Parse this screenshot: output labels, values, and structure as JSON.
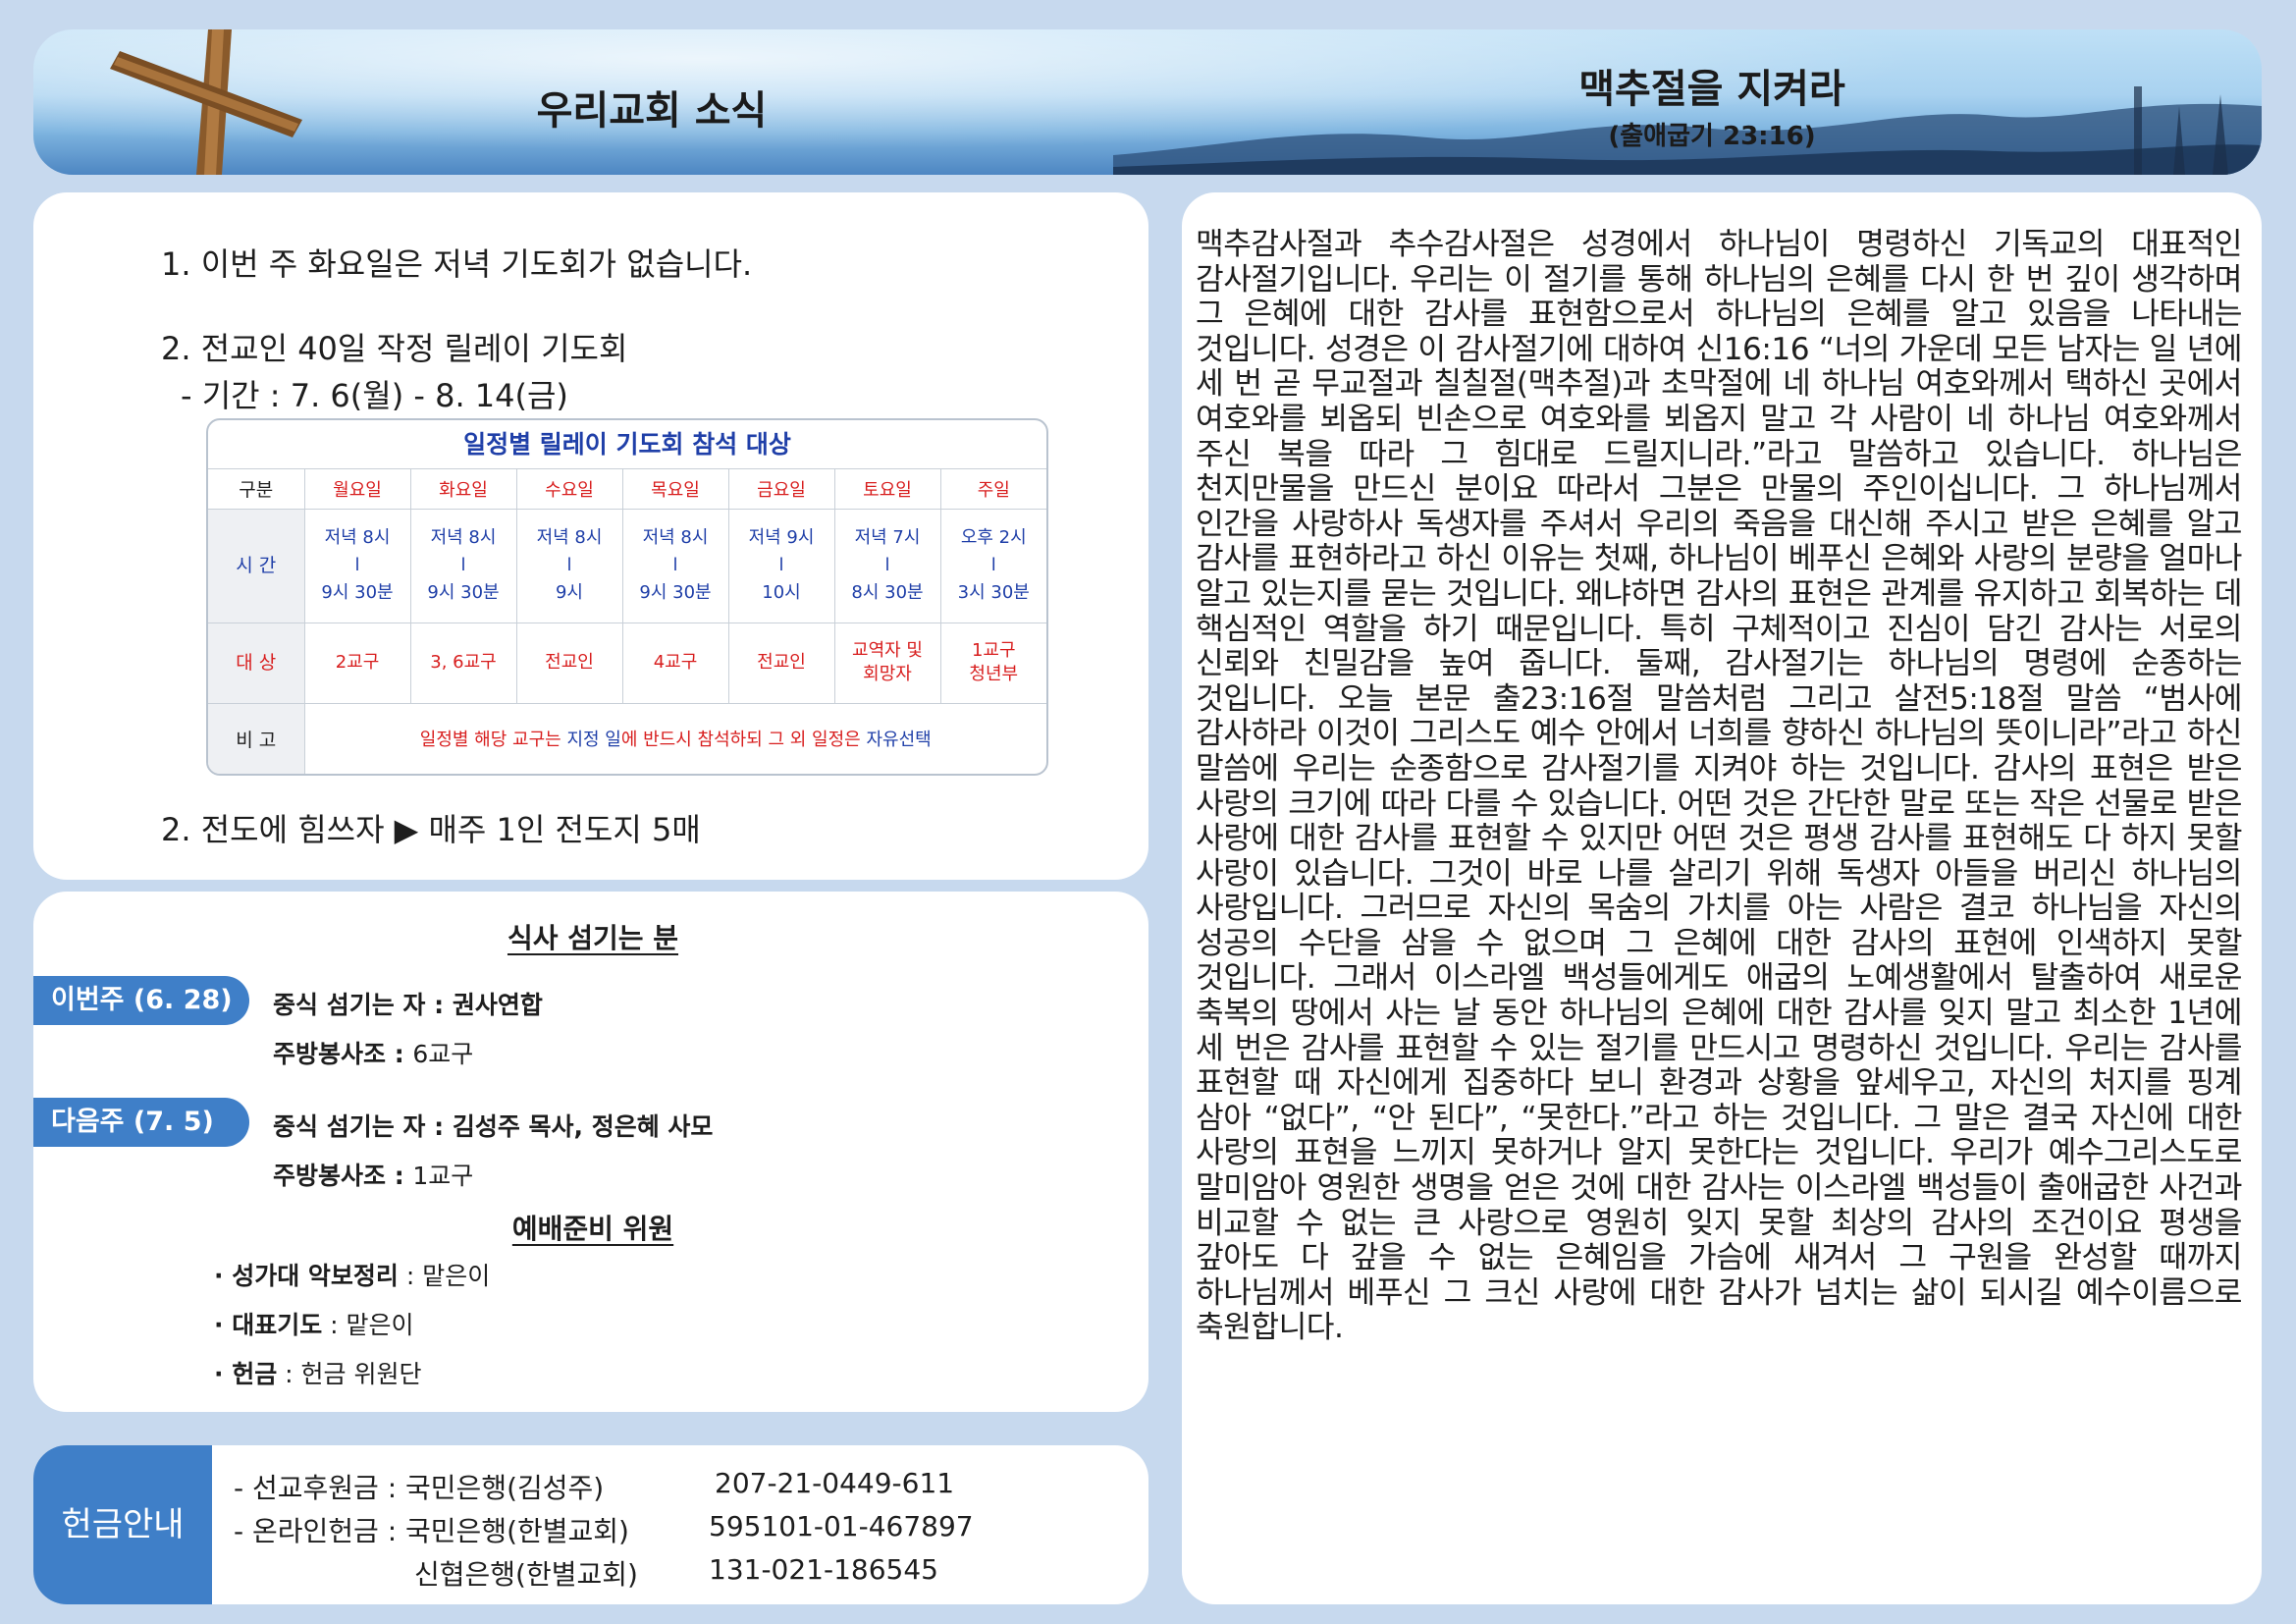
{
  "header": {
    "title": "우리교회 소식",
    "theme": "맥추절을 지켜라",
    "verse": "(출애굽기 23:16)"
  },
  "notices": {
    "item1": "1. 이번 주 화요일은 저녁 기도회가 없습니다.",
    "item2": "2. 전교인 40일 작정 릴레이 기도회",
    "item2_period": "- 기간 : 7. 6(월) - 8. 14(금)",
    "item3": "2. 전도에 힘쓰자 ▶ 매주 1인 전도지 5매"
  },
  "schedule": {
    "title": "일정별 릴레이 기도회 참석 대상",
    "header_label": "구분",
    "days": [
      "월요일",
      "화요일",
      "수요일",
      "목요일",
      "금요일",
      "토요일",
      "주일"
    ],
    "time_label": "시 간",
    "times": [
      [
        "저녁 8시",
        "l",
        "9시 30분"
      ],
      [
        "저녁 8시",
        "l",
        "9시 30분"
      ],
      [
        "저녁 8시",
        "l",
        "9시"
      ],
      [
        "저녁 8시",
        "l",
        "9시 30분"
      ],
      [
        "저녁 9시",
        "l",
        "10시"
      ],
      [
        "저녁 7시",
        "l",
        "8시 30분"
      ],
      [
        "오후 2시",
        "l",
        "3시 30분"
      ]
    ],
    "target_label": "대 상",
    "targets": [
      [
        "2교구"
      ],
      [
        "3, 6교구"
      ],
      [
        "전교인"
      ],
      [
        "4교구"
      ],
      [
        "전교인"
      ],
      [
        "교역자 및",
        "회망자"
      ],
      [
        "1교구",
        "청년부"
      ]
    ],
    "note_label": "비 고",
    "note": {
      "part1": "일정별 해당 교구는 ",
      "part2": "지정 일",
      "part3": "에 반드시 참석하되 그 외 일정은 ",
      "part4": "자유선택"
    }
  },
  "meal": {
    "title": "식사 섬기는 분",
    "this_week_tag": "이번주 (6. 28)",
    "this_week_server_label": "중식 섬기는 자 : ",
    "this_week_server": "권사연합",
    "this_week_kitchen_label": "주방봉사조 : ",
    "this_week_kitchen": "6교구",
    "next_week_tag": "다음주 (7. 5)",
    "next_week_server_label": "중식 섬기는 자 : ",
    "next_week_server": "김성주 목사, 정은혜 사모",
    "next_week_kitchen_label": "주방봉사조 : ",
    "next_week_kitchen": "1교구"
  },
  "prep": {
    "title": "예배준비 위원",
    "choir_label": "· 성가대 악보정리",
    "choir_value": " : 맡은이",
    "prayer_label": "· 대표기도",
    "prayer_value": " : 맡은이",
    "offering_label": "· 헌금",
    "offering_value": " : 헌금 위원단"
  },
  "offering": {
    "tag": "헌금안내",
    "line1_label": "- 선교후원금 : 국민은행(김성주)",
    "line1_account": "207-21-0449-611",
    "line2_label": "- 온라인헌금 : 국민은행(한별교회)",
    "line2_account": "595101-01-467897",
    "line3_label": "신협은행(한별교회)",
    "line3_account": "131-021-186545"
  },
  "sermon": {
    "body": "맥추감사절과 추수감사절은 성경에서 하나님이 명령하신 기독교의 대표적인 감사절기입니다. 우리는 이 절기를 통해 하나님의 은혜를 다시 한 번 깊이 생각하며 그 은혜에 대한 감사를 표현함으로서 하나님의 은혜를 알고 있음을 나타내는 것입니다. 성경은 이 감사절기에 대하여 신16:16 “너의 가운데 모든 남자는 일 년에 세 번 곧 무교절과 칠칠절(맥추절)과 초막절에 네 하나님 여호와께서 택하신 곳에서 여호와를 뵈옵되 빈손으로 여호와를 뵈옵지 말고 각 사람이 네 하나님 여호와께서 주신 복을 따라 그 힘대로 드릴지니라.”라고 말씀하고 있습니다. 하나님은 천지만물을 만드신 분이요 따라서 그분은 만물의 주인이십니다. 그 하나님께서 인간을 사랑하사 독생자를 주셔서 우리의 죽음을 대신해 주시고 받은 은혜를 알고 감사를 표현하라고 하신 이유는 첫째, 하나님이 베푸신 은혜와 사랑의 분량을 얼마나 알고 있는지를 묻는 것입니다. 왜냐하면 감사의 표현은 관계를 유지하고 회복하는 데 핵심적인 역할을 하기 때문입니다. 특히 구체적이고 진심이 담긴 감사는 서로의 신뢰와 친밀감을 높여 줍니다. 둘째, 감사절기는 하나님의 명령에 순종하는 것입니다. 오늘 본문 출23:16절 말씀처럼 그리고 살전5:18절 말씀 “범사에 감사하라 이것이 그리스도 예수 안에서 너희를 향하신 하나님의 뜻이니라”라고 하신 말씀에 우리는 순종함으로 감사절기를 지켜야 하는 것입니다. 감사의 표현은 받은 사랑의 크기에 따라 다를 수 있습니다. 어떤 것은 간단한 말로 또는 작은 선물로 받은 사랑에 대한 감사를 표현할 수 있지만 어떤 것은 평생 감사를 표현해도 다 하지 못할 사랑이 있습니다. 그것이 바로 나를 살리기 위해 독생자 아들을 버리신 하나님의 사랑입니다. 그러므로 자신의 목숨의 가치를 아는 사람은 결코 하나님을 자신의 성공의 수단을 삼을 수 없으며 그 은혜에 대한 감사의 표현에 인색하지 못할 것입니다. 그래서 이스라엘 백성들에게도 애굽의 노예생활에서 탈출하여 새로운 축복의 땅에서 사는 날 동안 하나님의 은혜에 대한 감사를 잊지 말고 최소한 1년에 세 번은 감사를 표현할 수 있는 절기를 만드시고 명령하신 것입니다. 우리는 감사를 표현할 때 자신에게 집중하다 보니 환경과 상황을 앞세우고, 자신의 처지를 핑계 삼아 “없다”, “안 된다”, “못한다.”라고 하는 것입니다. 그 말은 결국 자신에 대한 사랑의 표현을 느끼지 못하거나 알지 못한다는 것입니다. 우리가 예수그리스도로 말미암아 영원한 생명을 얻은 것에 대한 감사는 이스라엘 백성들이 출애굽한 사건과 비교할 수 없는 큰 사랑으로 영원히 잊지 못할 최상의 감사의 조건이요 평생을 갚아도 다 갚을 수 없는 은혜임을 가슴에 새겨서 그 구원을 완성할 때까지 하나님께서 베푸신 그 크신 사랑에 대한 감사가 넘치는 삶이 되시길 예수이름으로 축원합니다."
  }
}
